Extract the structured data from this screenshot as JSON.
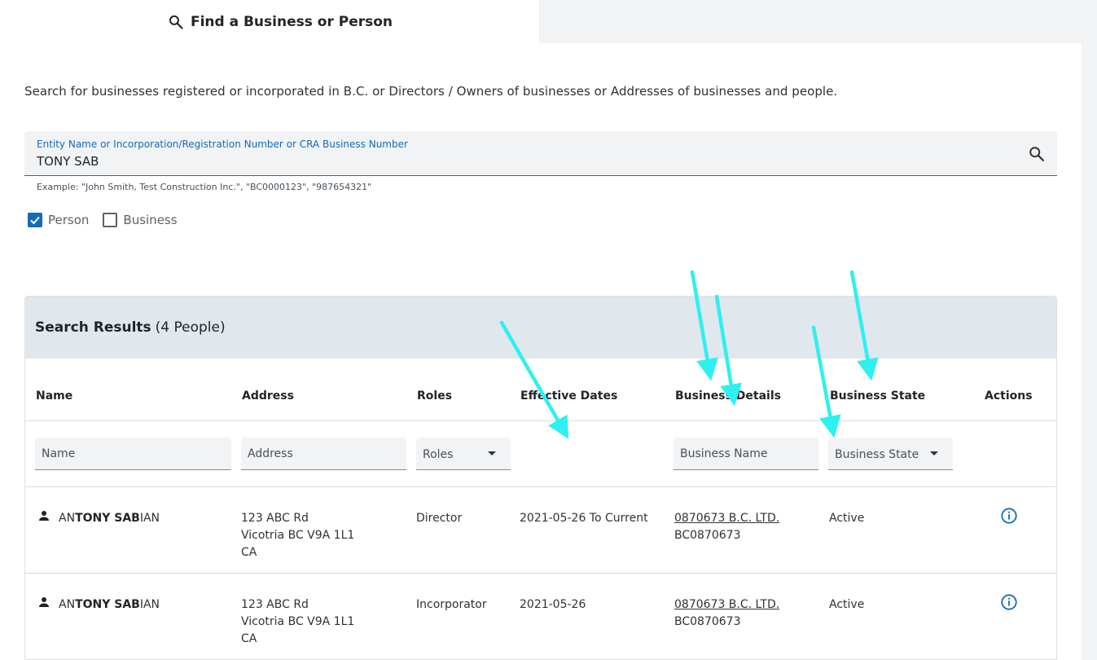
{
  "tab": {
    "label": "Find a Business or Person",
    "icon": "search-icon"
  },
  "description": "Search for businesses registered or incorporated in B.C.  or Directors / Owners of businesses or Addresses of businesses and people.",
  "search": {
    "label": "Entity Name or Incorporation/Registration Number or CRA Business Number",
    "value": "TONY SAB",
    "hint": "Example: \"John Smith, Test Construction Inc.\", \"BC0000123\", \"987654321\""
  },
  "filters": {
    "person": {
      "label": "Person",
      "checked": true
    },
    "business": {
      "label": "Business",
      "checked": false
    }
  },
  "results": {
    "title": "Search Results",
    "count": "(4 People)",
    "columns": [
      "Name",
      "Address",
      "Roles",
      "Effective Dates",
      "Business Details",
      "Business State",
      "Actions"
    ],
    "filter_placeholders": {
      "name": "Name",
      "address": "Address",
      "roles": "Roles",
      "business_name": "Business Name",
      "business_state": "Business State"
    },
    "rows": [
      {
        "name_pre": "AN",
        "name_match": "TONY SAB",
        "name_post": "IAN",
        "address": [
          "123 ABC Rd",
          "Vicotria BC V9A 1L1",
          "CA"
        ],
        "role": "Director",
        "dates": "2021-05-26 To Current",
        "business_name": "0870673 B.C. LTD.",
        "business_number": "BC0870673",
        "state": "Active"
      },
      {
        "name_pre": "AN",
        "name_match": "TONY SAB",
        "name_post": "IAN",
        "address": [
          "123 ABC Rd",
          "Vicotria BC V9A 1L1",
          "CA"
        ],
        "role": "Incorporator",
        "dates": "2021-05-26",
        "business_name": "0870673 B.C. LTD.",
        "business_number": "BC0870673",
        "state": "Active"
      }
    ]
  },
  "colors": {
    "primary": "#1669bb",
    "header_bg": "#e0e7ed",
    "annotation_arrow": "#2ef0f0"
  }
}
